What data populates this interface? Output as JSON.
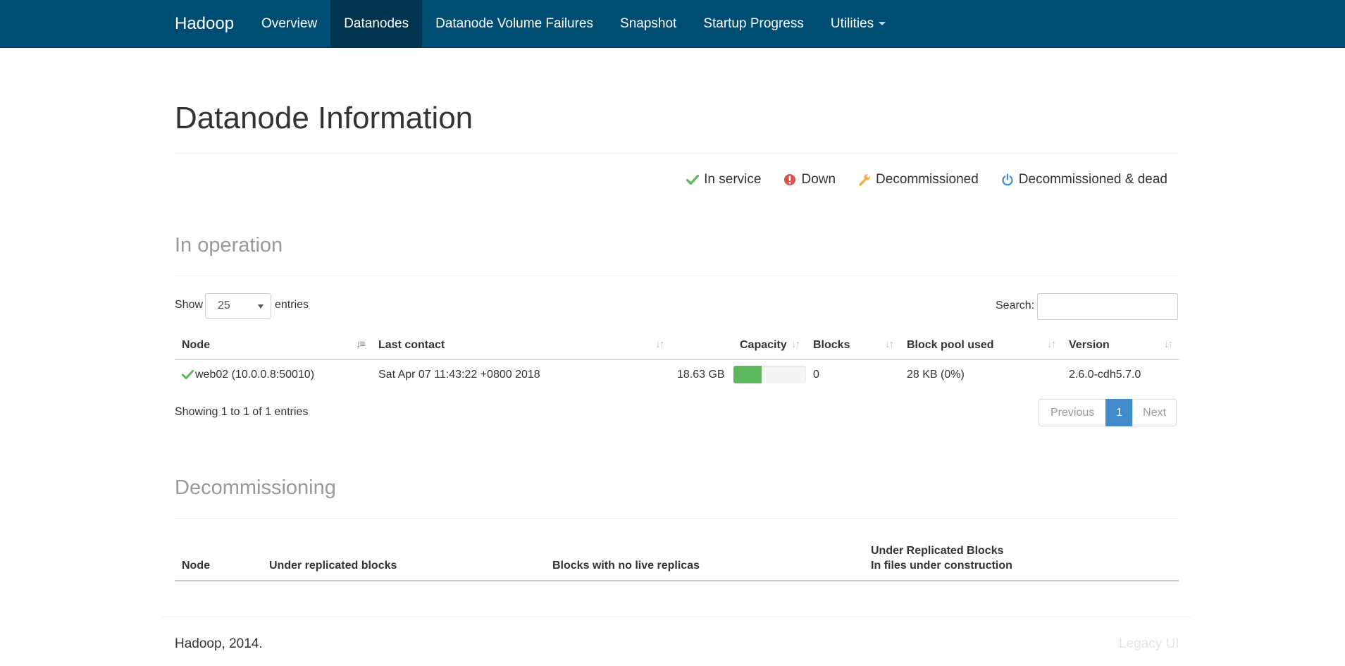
{
  "navbar": {
    "brand": "Hadoop",
    "items": [
      {
        "label": "Overview",
        "active": false
      },
      {
        "label": "Datanodes",
        "active": true
      },
      {
        "label": "Datanode Volume Failures",
        "active": false
      },
      {
        "label": "Snapshot",
        "active": false
      },
      {
        "label": "Startup Progress",
        "active": false
      },
      {
        "label": "Utilities",
        "active": false,
        "dropdown": true
      }
    ]
  },
  "page": {
    "title": "Datanode Information"
  },
  "legend": [
    {
      "icon": "check-icon",
      "label": "In service",
      "color": "#5cb85c"
    },
    {
      "icon": "exclamation-circle-icon",
      "label": "Down",
      "color": "#d9534f"
    },
    {
      "icon": "wrench-icon",
      "label": "Decommissioned",
      "color": "#f0ad4e"
    },
    {
      "icon": "power-off-icon",
      "label": "Decommissioned & dead",
      "color": "#428bca"
    }
  ],
  "in_operation": {
    "heading": "In operation",
    "show_label": "Show",
    "page_size": "25",
    "entries_label": "entries",
    "search_label": "Search:",
    "search_value": "",
    "columns": [
      "Node",
      "Last contact",
      "Capacity",
      "Blocks",
      "Block pool used",
      "Version"
    ],
    "rows": [
      {
        "node": "web02 (10.0.0.8:50010)",
        "last_contact": "Sat Apr 07 11:43:22 +0800 2018",
        "capacity": "18.63 GB",
        "capacity_used_fraction": 0.39,
        "blocks": "0",
        "block_pool_used": "28 KB (0%)",
        "version": "2.6.0-cdh5.7.0"
      }
    ],
    "info": "Showing 1 to 1 of 1 entries",
    "pagination": {
      "previous": "Previous",
      "current": "1",
      "next": "Next"
    }
  },
  "decommissioning": {
    "heading": "Decommissioning",
    "columns": [
      "Node",
      "Under replicated blocks",
      "Blocks with no live replicas",
      "Under Replicated Blocks",
      "In files under construction"
    ]
  },
  "footer": {
    "text": "Hadoop, 2014.",
    "legacy_link": "Legacy UI"
  },
  "colors": {
    "navbar": "#004d73",
    "navbar_active": "#00344e",
    "primary": "#428bca",
    "success": "#5cb85c"
  }
}
